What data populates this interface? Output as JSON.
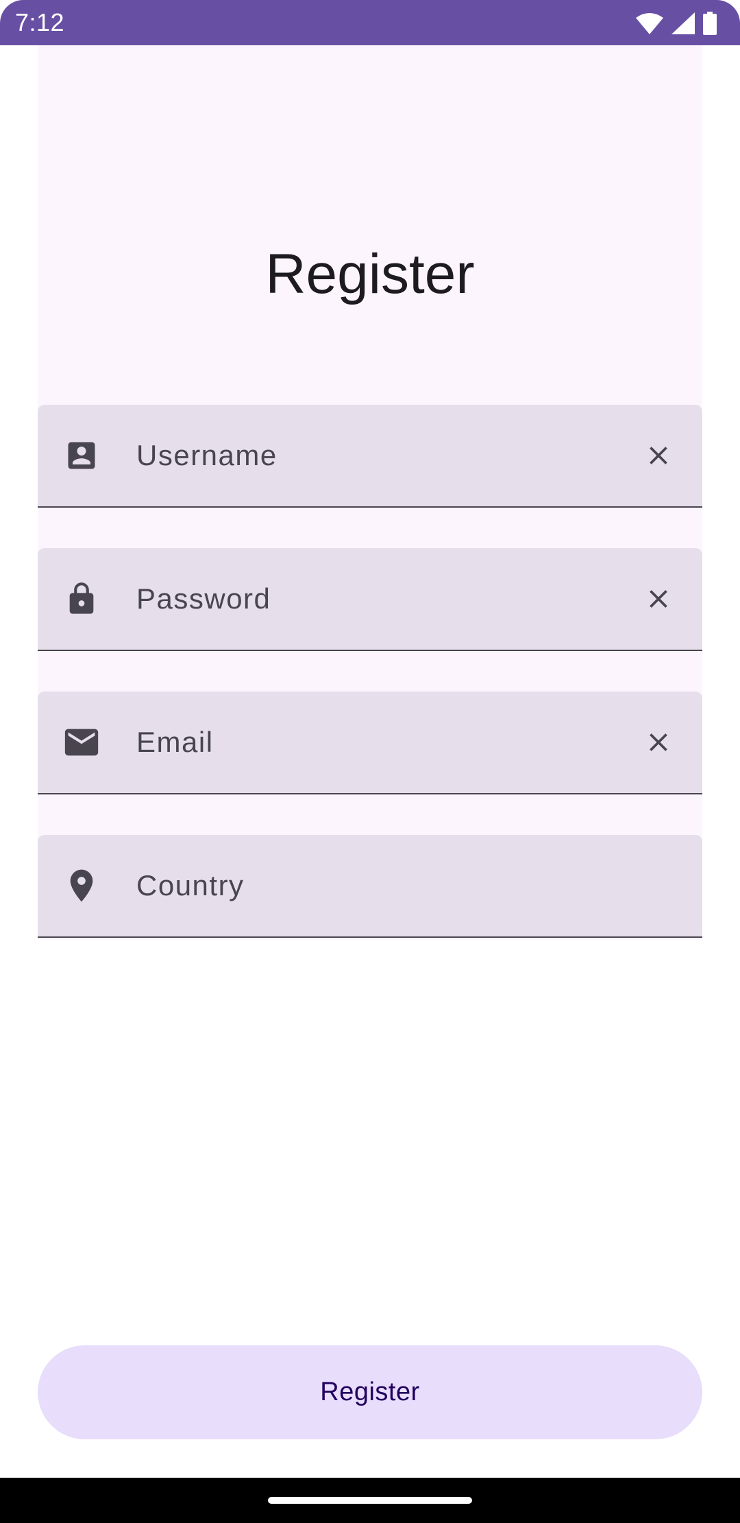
{
  "status_bar": {
    "time": "7:12",
    "icons": [
      "wifi-icon",
      "signal-icon",
      "battery-icon"
    ],
    "background": "#6750A4"
  },
  "page": {
    "title": "Register"
  },
  "fields": [
    {
      "placeholder": "Username",
      "lead_icon": "account-box-icon",
      "trailing_icon": "close-icon"
    },
    {
      "placeholder": "Password",
      "lead_icon": "lock-icon",
      "trailing_icon": "close-icon"
    },
    {
      "placeholder": "Email",
      "lead_icon": "mail-icon",
      "trailing_icon": "close-icon"
    },
    {
      "placeholder": "Country",
      "lead_icon": "location-pin-icon"
    }
  ],
  "register_button": {
    "label": "Register",
    "background": "#E8DDFB",
    "text_color": "#21005D"
  },
  "colors": {
    "field_background": "#E6DFEB",
    "panel_background": "#FCF5FD",
    "icon_color": "#49454F"
  }
}
